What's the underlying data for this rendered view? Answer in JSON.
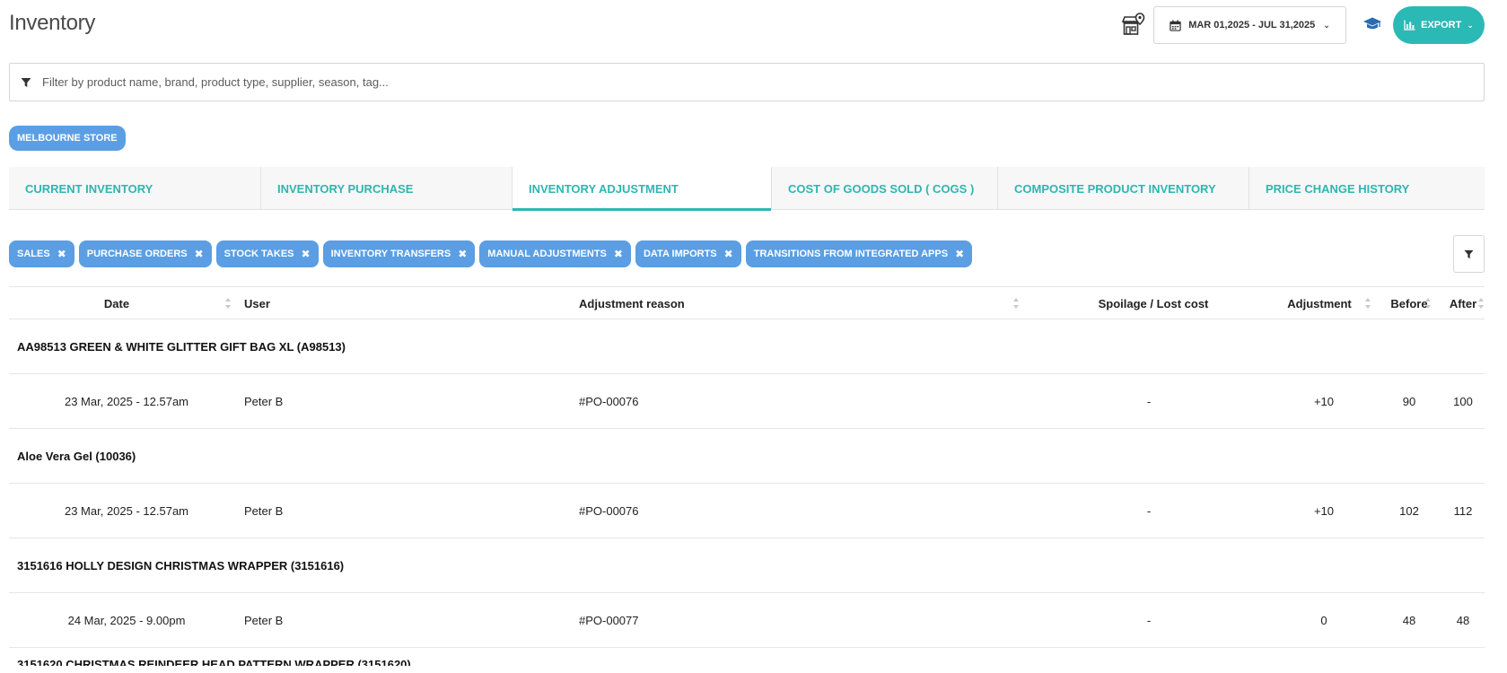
{
  "header": {
    "title": "Inventory",
    "date_range": "MAR 01,2025 - JUL 31,2025",
    "export_label": "EXPORT",
    "icons": {
      "store": "store-location-icon",
      "calendar": "calendar-icon",
      "help": "graduation-cap-icon",
      "export": "bar-chart-icon"
    }
  },
  "filter": {
    "placeholder": "Filter by product name, brand, product type, supplier, season, tag..."
  },
  "store": {
    "label": "MELBOURNE STORE"
  },
  "tabs": [
    {
      "label": "CURRENT INVENTORY",
      "active": false
    },
    {
      "label": "INVENTORY PURCHASE",
      "active": false
    },
    {
      "label": "INVENTORY ADJUSTMENT",
      "active": true
    },
    {
      "label": "COST OF GOODS SOLD ( COGS )",
      "active": false
    },
    {
      "label": "COMPOSITE PRODUCT INVENTORY",
      "active": false
    },
    {
      "label": "PRICE CHANGE HISTORY",
      "active": false
    }
  ],
  "chips": [
    {
      "label": "SALES"
    },
    {
      "label": "PURCHASE ORDERS"
    },
    {
      "label": "STOCK TAKES"
    },
    {
      "label": "INVENTORY TRANSFERS"
    },
    {
      "label": "MANUAL ADJUSTMENTS"
    },
    {
      "label": "DATA IMPORTS"
    },
    {
      "label": "TRANSITIONS FROM INTEGRATED APPS"
    }
  ],
  "table": {
    "columns": {
      "date": "Date",
      "user": "User",
      "reason": "Adjustment reason",
      "spoilage": "Spoilage / Lost cost",
      "adjustment": "Adjustment",
      "before": "Before",
      "after": "After"
    },
    "groups": [
      {
        "product": "AA98513 GREEN & WHITE GLITTER GIFT BAG XL (A98513)",
        "rows": [
          {
            "date": "23 Mar, 2025 - 12.57am",
            "user": "Peter B",
            "reason": "#PO-00076",
            "spoilage": "-",
            "adjustment": "+10",
            "before": "90",
            "after": "100"
          }
        ]
      },
      {
        "product": "Aloe Vera Gel (10036)",
        "rows": [
          {
            "date": "23 Mar, 2025 - 12.57am",
            "user": "Peter B",
            "reason": "#PO-00076",
            "spoilage": "-",
            "adjustment": "+10",
            "before": "102",
            "after": "112"
          }
        ]
      },
      {
        "product": "3151616 HOLLY DESIGN CHRISTMAS WRAPPER (3151616)",
        "rows": [
          {
            "date": "24 Mar, 2025 - 9.00pm",
            "user": "Peter B",
            "reason": "#PO-00077",
            "spoilage": "-",
            "adjustment": "0",
            "before": "48",
            "after": "48"
          }
        ]
      }
    ],
    "partial_group": "3151620 CHRISTMAS REINDEER HEAD PATTERN WRAPPER (3151620)"
  }
}
